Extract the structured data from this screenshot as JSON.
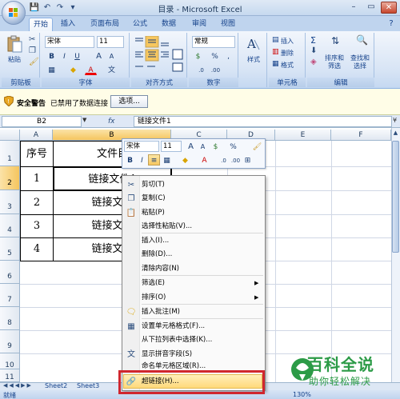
{
  "window": {
    "title": "目录 - Microsoft Excel",
    "min": "–",
    "max": "▭",
    "close": "✕",
    "qat": [
      "💾",
      "↶",
      "↷",
      "▾"
    ]
  },
  "tabs": [
    "开始",
    "插入",
    "页面布局",
    "公式",
    "数据",
    "审阅",
    "视图"
  ],
  "ribbon": {
    "clipboard": {
      "paste": "粘贴",
      "label": "剪贴板"
    },
    "font": {
      "name": "宋体",
      "size": "11",
      "label": "字体",
      "bold": "B",
      "italic": "I",
      "underline": "U",
      "grow": "A",
      "shrink": "A",
      "color": "A"
    },
    "alignment": {
      "label": "对齐方式"
    },
    "number": {
      "format": "常规",
      "label": "数字",
      "percent": "%",
      "comma": ",",
      "currency": "$"
    },
    "styles": {
      "button": "样式"
    },
    "cells": {
      "insert": "插入",
      "delete": "删除",
      "format": "格式",
      "label": "单元格"
    },
    "editing": {
      "sigma": "Σ",
      "sort": "排序和\n筛选",
      "find": "查找和\n选择",
      "label": "编辑"
    }
  },
  "security": {
    "title": "安全警告",
    "message": "已禁用了数据连接",
    "options": "选项..."
  },
  "formulabar": {
    "name": "B2",
    "fx": "fx",
    "content": "链接文件1"
  },
  "columns": [
    "A",
    "B",
    "C",
    "D",
    "E",
    "F"
  ],
  "rows": [
    "1",
    "2",
    "3",
    "4",
    "5",
    "6",
    "7",
    "8",
    "9",
    "10",
    "11"
  ],
  "table": {
    "header": [
      "序号",
      "文件目"
    ],
    "rows": [
      [
        "1",
        "链接文件1"
      ],
      [
        "2",
        "链接文件"
      ],
      [
        "3",
        "链接文件"
      ],
      [
        "4",
        "链接文件"
      ]
    ]
  },
  "mini_toolbar": {
    "font": "宋体",
    "size": "11",
    "percent": "%"
  },
  "context_menu": [
    {
      "label": "剪切(T)",
      "icon": "✂"
    },
    {
      "label": "复制(C)",
      "icon": "❐"
    },
    {
      "label": "粘贴(P)",
      "icon": "📋"
    },
    {
      "label": "选择性粘贴(V)...",
      "icon": ""
    },
    {
      "label": "插入(I)...",
      "icon": ""
    },
    {
      "label": "删除(D)...",
      "icon": ""
    },
    {
      "label": "清除内容(N)",
      "icon": ""
    },
    {
      "label": "筛选(E)",
      "icon": ""
    },
    {
      "label": "排序(O)",
      "icon": ""
    },
    {
      "label": "插入批注(M)",
      "icon": "🗨"
    },
    {
      "label": "设置单元格格式(F)...",
      "icon": "▦"
    },
    {
      "label": "从下拉列表中选择(K)...",
      "icon": ""
    },
    {
      "label": "显示拼音字段(S)",
      "icon": "文"
    },
    {
      "label": "命名单元格区域(R)...",
      "icon": ""
    },
    {
      "label": "超链接(H)...",
      "icon": "🔗"
    }
  ],
  "sheets": [
    "Sheet2",
    "Sheet3"
  ],
  "status": {
    "ready": "就绪",
    "zoom": "130%"
  },
  "watermark": {
    "big": "百科全说",
    "small": "助你轻松解决"
  },
  "colors": {
    "highlight": "#d0262e",
    "ribbon": "#d7e4f5"
  }
}
